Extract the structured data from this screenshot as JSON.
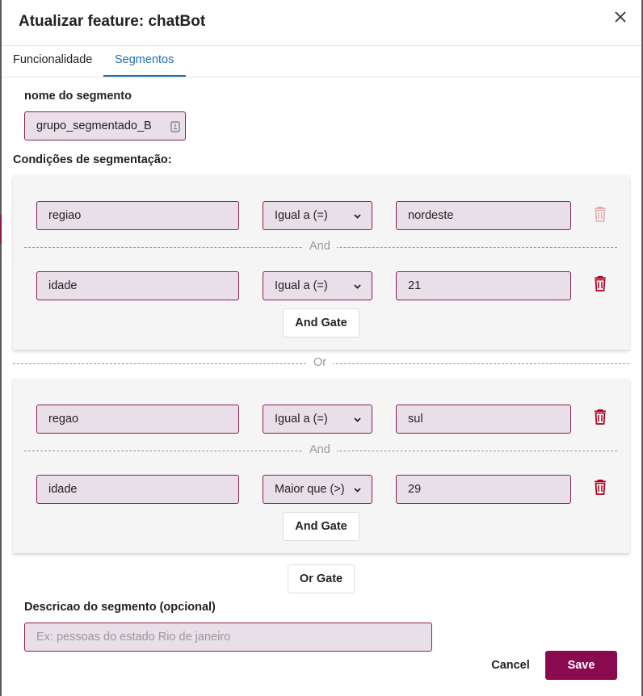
{
  "dialog": {
    "title": "Atualizar feature: chatBot"
  },
  "tabs": [
    {
      "label": "Funcionalidade",
      "active": false
    },
    {
      "label": "Segmentos",
      "active": true
    }
  ],
  "segment": {
    "name_label": "nome do segmento",
    "name_value": "grupo_segmentado_B",
    "conditions_label": "Condições de segmentação:"
  },
  "groups": [
    {
      "conditions": [
        {
          "field": "regiao",
          "operator": "Igual a (=)",
          "value": "nordeste",
          "delete_disabled": true
        },
        {
          "field": "idade",
          "operator": "Igual a (=)",
          "value": "21",
          "delete_disabled": false
        }
      ],
      "connector": "And",
      "gate_label": "And Gate"
    },
    {
      "conditions": [
        {
          "field": "regao",
          "operator": "Igual a (=)",
          "value": "sul",
          "delete_disabled": false
        },
        {
          "field": "idade",
          "operator": "Maior que (>)",
          "value": "29",
          "delete_disabled": false
        }
      ],
      "connector": "And",
      "gate_label": "And Gate"
    }
  ],
  "or_connector": "Or",
  "or_gate_label": "Or Gate",
  "description": {
    "label": "Descricao do segmento (opcional)",
    "placeholder": "Ex: pessoas do estado Rio de janeiro",
    "value": ""
  },
  "footer": {
    "cancel_label": "Cancel",
    "save_label": "Save"
  },
  "colors": {
    "accent": "#8a0a4f",
    "input_bg": "#e8dfe8",
    "input_border": "#8b1e55",
    "tab_active": "#1f6fb5",
    "trash": "#b00020"
  }
}
